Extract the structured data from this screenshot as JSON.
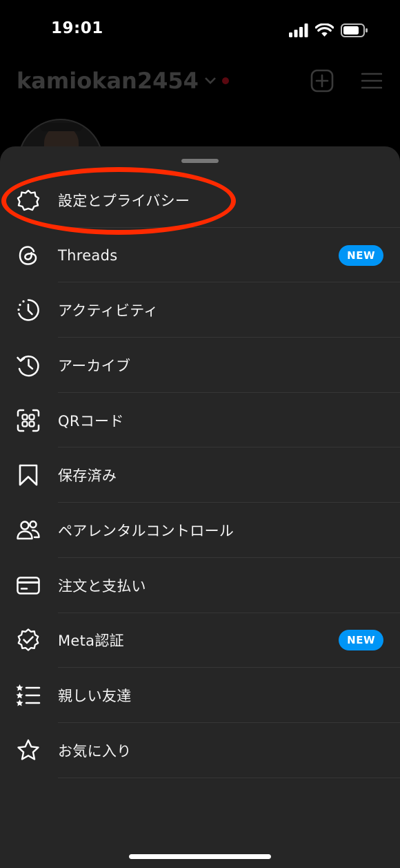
{
  "status_bar": {
    "time": "19:01"
  },
  "profile": {
    "username": "kamiokan2454"
  },
  "menu": {
    "items": [
      {
        "label": "設定とプライバシー",
        "icon": "settings-icon",
        "badge": ""
      },
      {
        "label": "Threads",
        "icon": "threads-icon",
        "badge": "NEW"
      },
      {
        "label": "アクティビティ",
        "icon": "activity-icon",
        "badge": ""
      },
      {
        "label": "アーカイブ",
        "icon": "archive-icon",
        "badge": ""
      },
      {
        "label": "QRコード",
        "icon": "qr-code-icon",
        "badge": ""
      },
      {
        "label": "保存済み",
        "icon": "bookmark-icon",
        "badge": ""
      },
      {
        "label": "ペアレンタルコントロール",
        "icon": "parental-control-icon",
        "badge": ""
      },
      {
        "label": "注文と支払い",
        "icon": "card-icon",
        "badge": ""
      },
      {
        "label": "Meta認証",
        "icon": "verified-icon",
        "badge": "NEW"
      },
      {
        "label": "親しい友達",
        "icon": "close-friends-icon",
        "badge": ""
      },
      {
        "label": "お気に入り",
        "icon": "star-icon",
        "badge": ""
      }
    ]
  },
  "colors": {
    "highlight": "#ff2a00",
    "badge": "#0095f6",
    "sheet": "#262626"
  }
}
